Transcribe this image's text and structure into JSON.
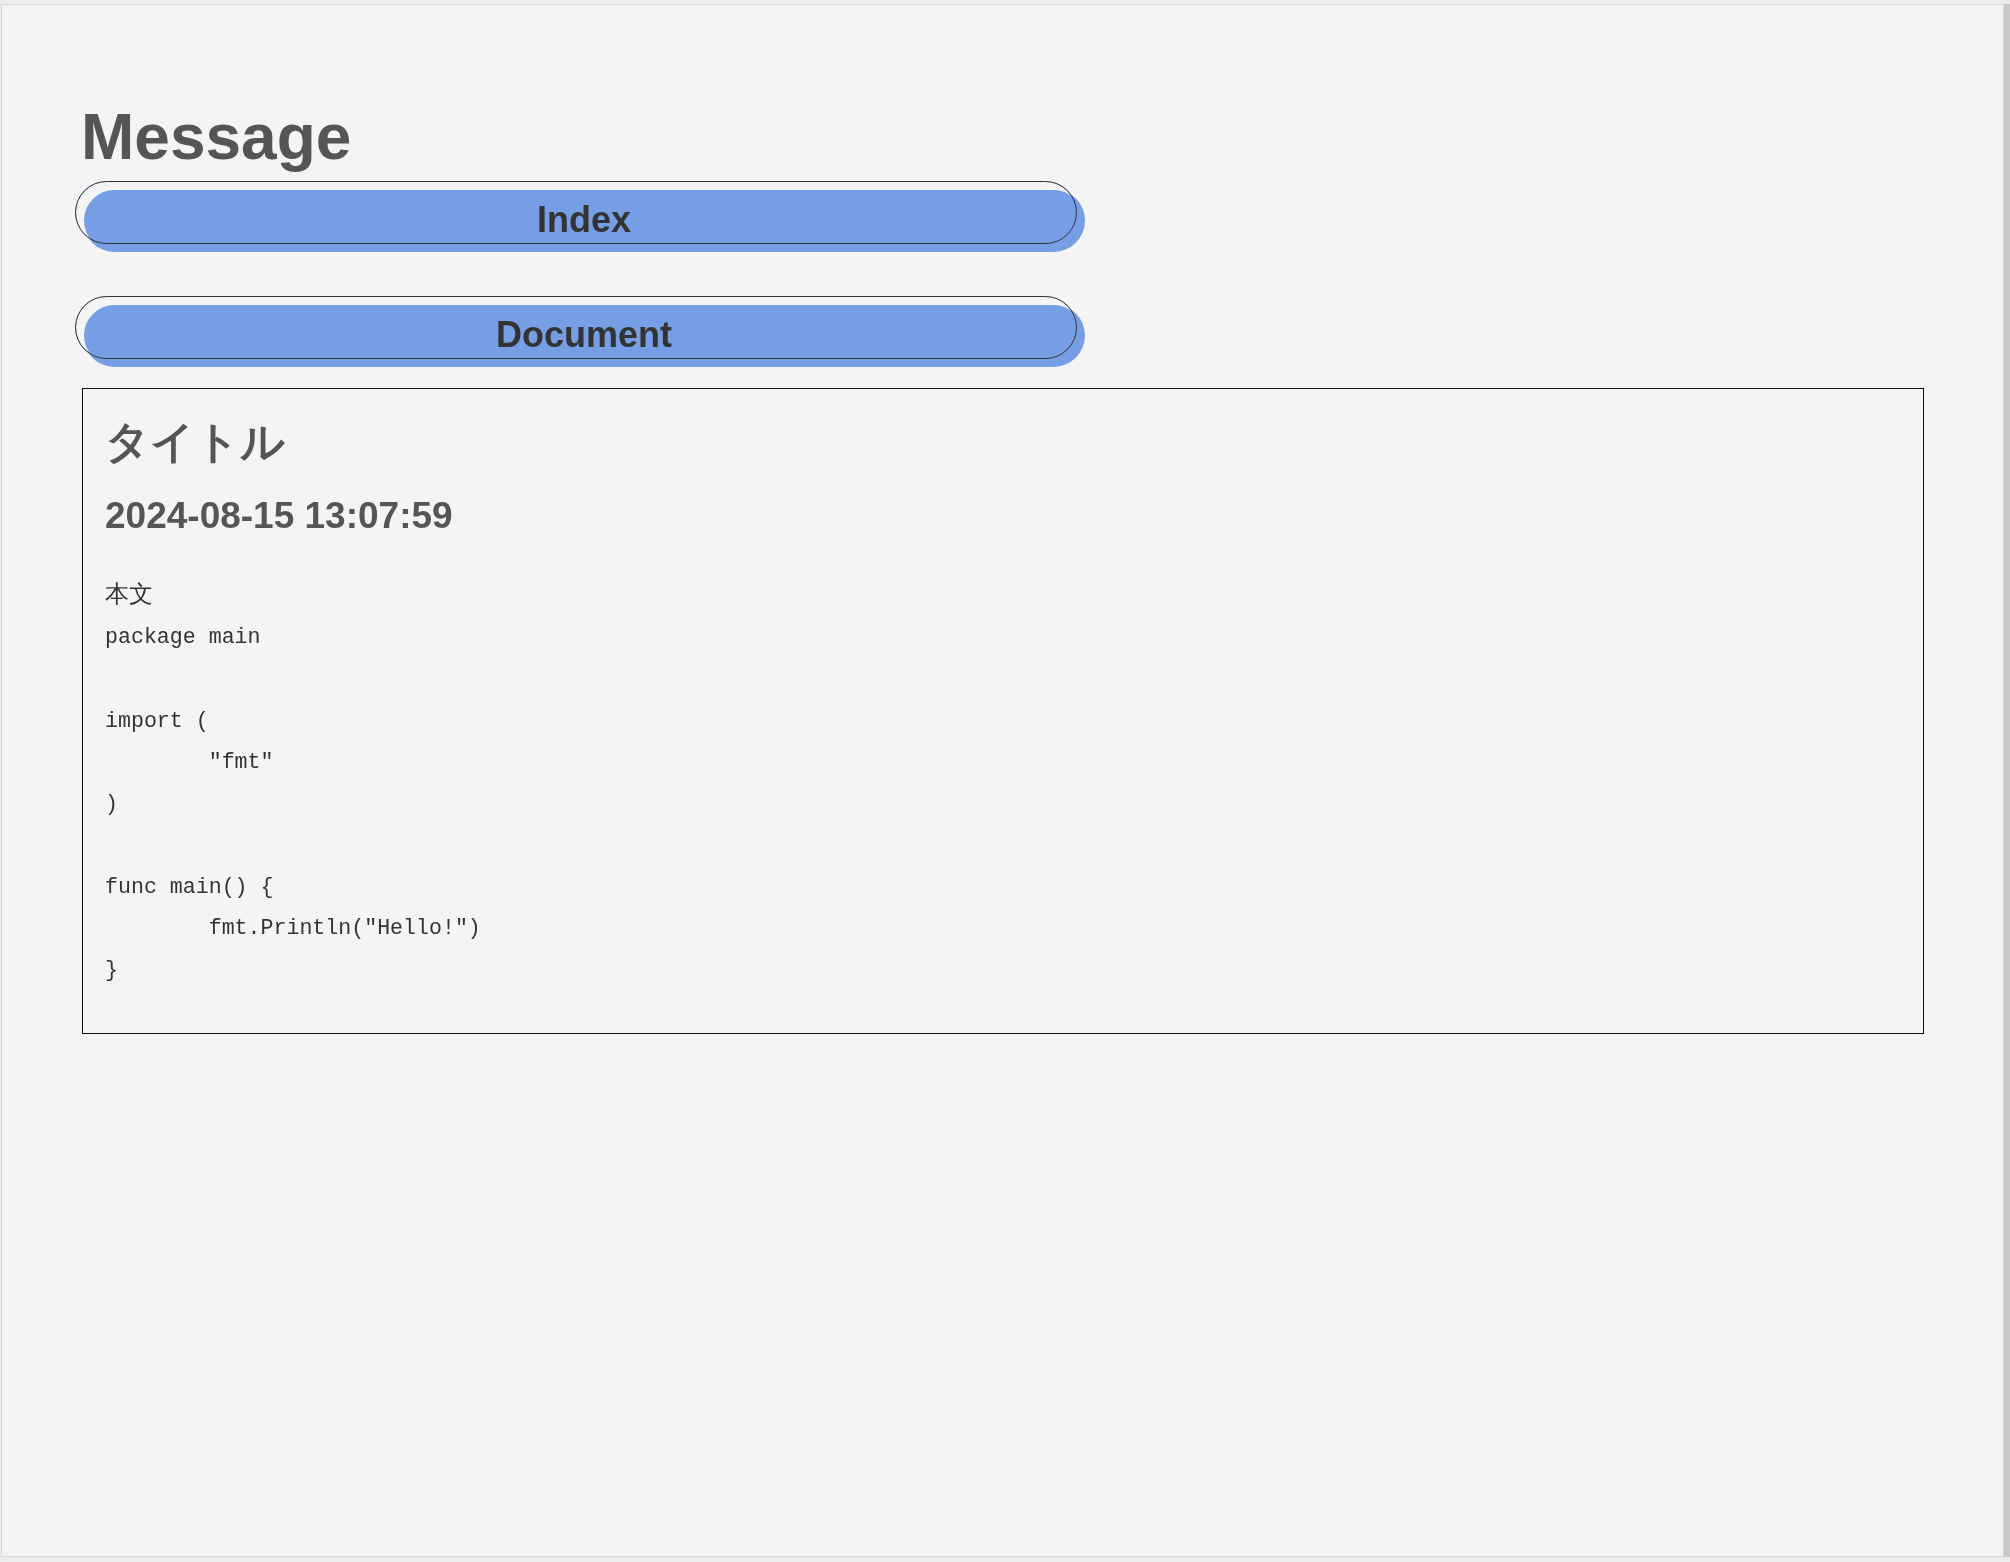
{
  "heading": "Message",
  "nav_buttons": [
    {
      "label": "Index"
    },
    {
      "label": "Document"
    }
  ],
  "message": {
    "title": "タイトル",
    "timestamp": "2024-08-15 13:07:59",
    "body_label": "本文",
    "body": "package main\n\nimport (\n\t\"fmt\"\n)\n\nfunc main() {\n\tfmt.Println(\"Hello!\")\n}"
  }
}
